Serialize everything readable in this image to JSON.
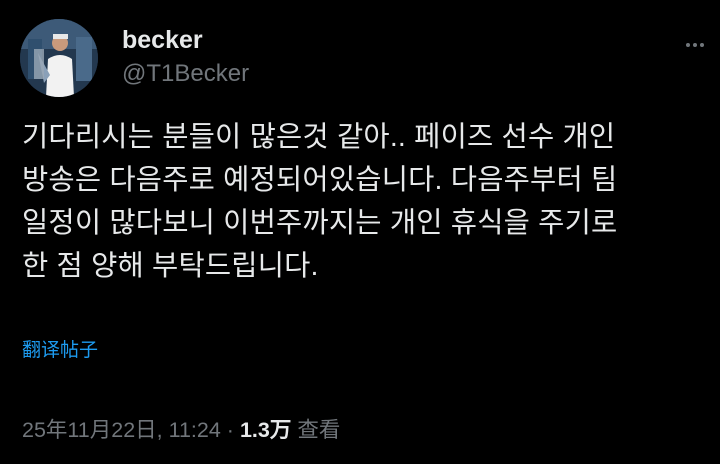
{
  "author": {
    "display_name": "becker",
    "handle": "@T1Becker",
    "avatar_icon": "profile-photo"
  },
  "tweet": {
    "lines": [
      "기다리시는 분들이 많은것 같아.. 페이즈 선수 개인",
      "방송은 다음주로 예정되어있습니다. 다음주부터 팀",
      "일정이 많다보니 이번주까지는 개인 휴식을 주기로",
      "한 점 양해 부탁드립니다."
    ],
    "translate_label": "翻译帖子",
    "timestamp": "25年11月22日, 11:24",
    "separator": "·",
    "views_count": "1.3万",
    "views_label": "查看"
  },
  "colors": {
    "background": "#000000",
    "text": "#e7e9ea",
    "secondary": "#71767b",
    "link": "#1d9bf0"
  }
}
